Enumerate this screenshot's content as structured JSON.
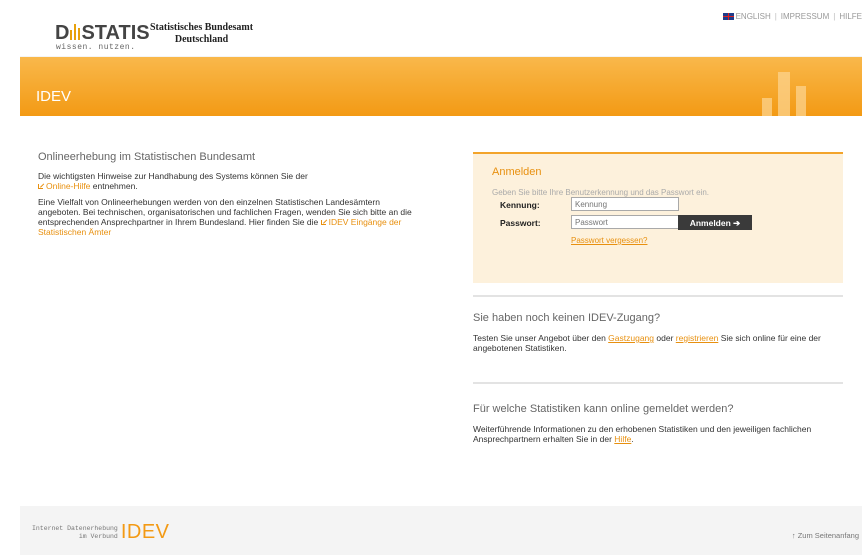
{
  "header": {
    "logo_text": "D STATIS",
    "logo_tagline": "wissen. nutzen.",
    "org_line1": "Statistisches Bundesamt",
    "org_line2": "Deutschland",
    "toplinks": {
      "english": "ENGLISH",
      "impressum": "IMPRESSUM",
      "hilfe": "HILFE"
    }
  },
  "banner": {
    "title": "IDEV"
  },
  "left": {
    "heading": "Onlineerhebung im Statistischen Bundesamt",
    "p1_text": "Die wichtigsten Hinweise zur Handhabung des Systems können Sie der",
    "p1_link": "Online-Hilfe",
    "p1_end": "entnehmen.",
    "p2_text": "Eine Vielfalt von Onlineerhebungen werden von den einzelnen Statistischen Landesämtern angeboten. Bei technischen, organisatorischen und fachlichen Fragen, wenden Sie sich bitte an die entsprechenden Ansprechpartner in Ihrem Bundesland. Hier finden Sie die",
    "p2_link": "IDEV Eingänge der Statistischen Ämter"
  },
  "login": {
    "title": "Anmelden",
    "hint": "Geben Sie bitte Ihre Benutzerkennung und das Passwort ein.",
    "kennung_label": "Kennung:",
    "kennung_placeholder": "Kennung",
    "passwort_label": "Passwort:",
    "passwort_placeholder": "Passwort",
    "button": "Anmelden",
    "forgot": "Passwort vergessen?"
  },
  "no_access": {
    "heading": "Sie haben noch keinen IDEV-Zugang?",
    "t1": "Testen Sie unser Angebot über den",
    "link1": "Gastzugang",
    "t2": "oder",
    "link2": "registrieren",
    "t3": "Sie sich online für eine der angebotenen Statistiken."
  },
  "which_stats": {
    "heading": "Für welche Statistiken kann online gemeldet werden?",
    "t1": "Weiterführende Informationen zu den erhobenen Statistiken und den jeweiligen fachlichen Ansprechpartnern erhalten Sie in der",
    "link": "Hilfe",
    "t2": "."
  },
  "footer": {
    "small_line1": "Internet Datenerhebung",
    "small_line2": "im Verbund",
    "idev": "IDEV",
    "to_top": "↑ Zum Seitenanfang"
  },
  "colors": {
    "accent": "#f39a14",
    "link": "#e8900f",
    "login_bg": "#fdf1dc"
  }
}
